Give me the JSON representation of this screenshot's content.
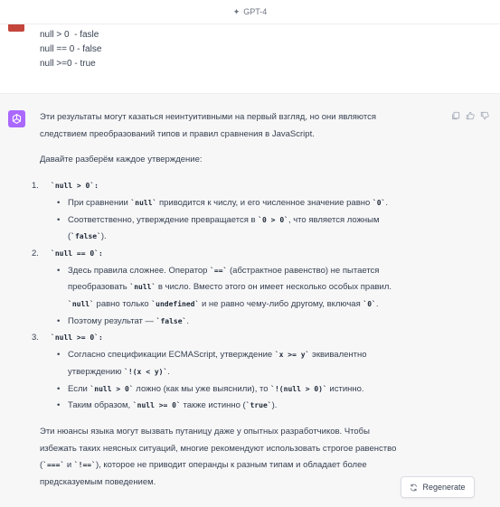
{
  "header": {
    "model_label": "GPT-4"
  },
  "user_message": {
    "lines": [
      "null > 0  - fasle",
      "null == 0 - false",
      "null >=0 - true"
    ]
  },
  "assistant": {
    "intro_1": "Эти результаты могут казаться неинтуитивными на первый взгляд, но они являются",
    "intro_2": "следствием преобразований типов и правил сравнения в JavaScript.",
    "lead": "Давайте разберём каждое утверждение:",
    "items": [
      {
        "num": "1.",
        "title": "`null > 0`:",
        "b1_a": "При сравнении ",
        "b1_code": "`null`",
        "b1_b": " приводится к числу, и его численное значение равно ",
        "b1_code2": "`0`",
        "b1_c": ".",
        "b2_a": "Соответственно, утверждение превращается в ",
        "b2_code": "`0 > 0`",
        "b2_b": ", что является ложным",
        "b2_l2_a": "(",
        "b2_l2_code": "`false`",
        "b2_l2_b": ")."
      },
      {
        "num": "2.",
        "title": "`null == 0`:",
        "b1_a": "Здесь правила сложнее. Оператор ",
        "b1_code": "`==`",
        "b1_b": " (абстрактное равенство) не пытается",
        "b1_l2_a": "преобразовать ",
        "b1_l2_code": "`null`",
        "b1_l2_b": " в число. Вместо этого он имеет несколько особых правил.",
        "b1_l3_code": "`null`",
        "b1_l3_a": " равно только ",
        "b1_l3_code2": "`undefined`",
        "b1_l3_b": " и не равно чему-либо другому, включая ",
        "b1_l3_code3": "`0`",
        "b1_l3_c": ".",
        "b2_a": "Поэтому результат — ",
        "b2_code": "`false`",
        "b2_b": "."
      },
      {
        "num": "3.",
        "title": "`null >= 0`:",
        "b1_a": "Согласно спецификации ECMAScript, утверждение ",
        "b1_code": "`x >= y`",
        "b1_b": " эквивалентно",
        "b1_l2_a": "утверждению ",
        "b1_l2_code": "`!(x < y)`",
        "b1_l2_b": ".",
        "b2_a": "Если ",
        "b2_code": "`null > 0`",
        "b2_b": " ложно (как мы уже выяснили), то ",
        "b2_code2": "`!(null > 0)`",
        "b2_c": " истинно.",
        "b3_a": "Таким образом, ",
        "b3_code": "`null >= 0`",
        "b3_b": " также истинно (",
        "b3_code2": "`true`",
        "b3_c": ")."
      }
    ],
    "outro_1": "Эти нюансы языка могут вызвать путаницу даже у опытных разработчиков. Чтобы",
    "outro_2": "избежать таких неясных ситуаций, многие рекомендуют использовать строгое равенство",
    "outro_3_a": "(",
    "outro_3_code": "`===`",
    "outro_3_b": " и ",
    "outro_3_code2": "`!==`",
    "outro_3_c": "), которое не приводит операнды к разным типам и обладает более",
    "outro_4": "предсказуемым поведением."
  },
  "regenerate": {
    "label": "Regenerate"
  }
}
